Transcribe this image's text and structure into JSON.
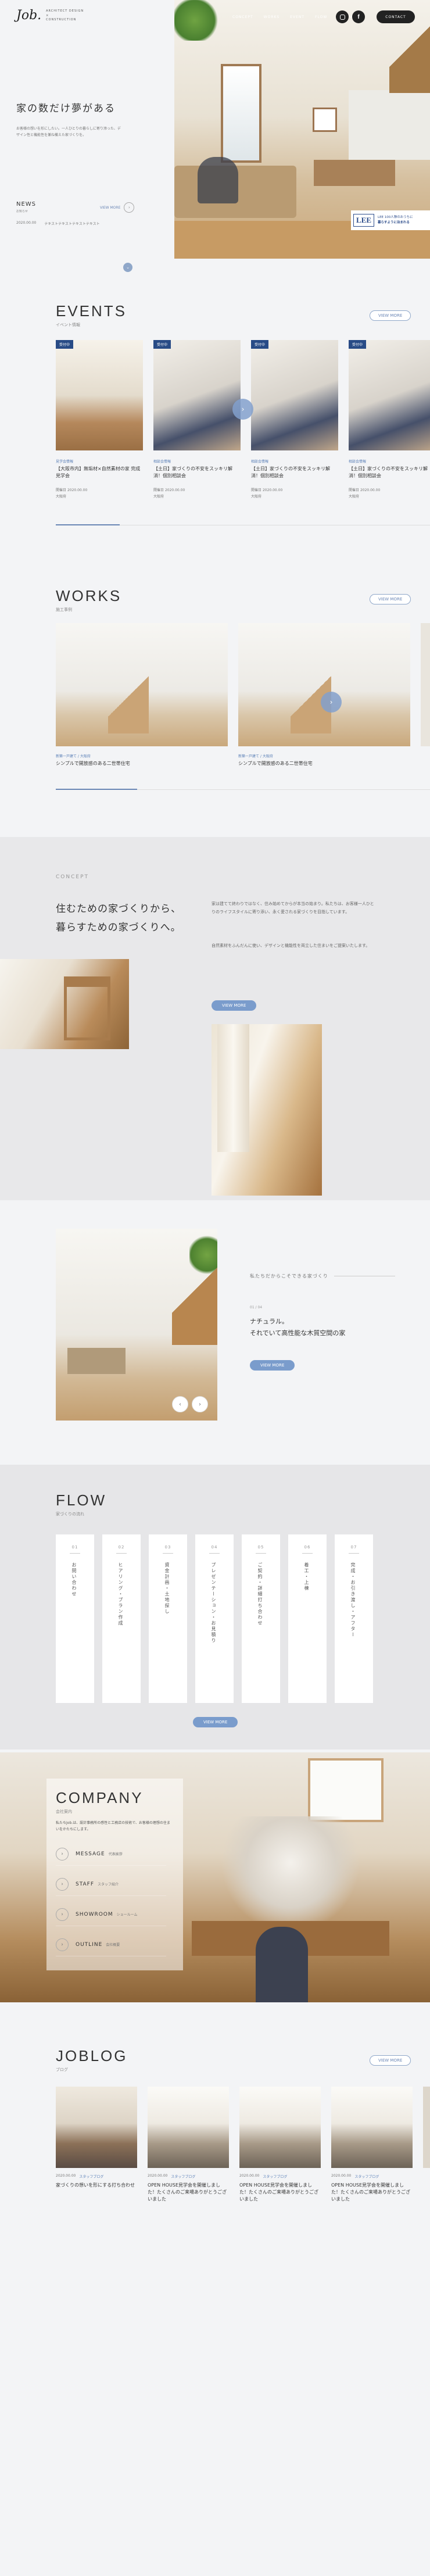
{
  "header": {
    "logo": "Job.",
    "logo_sub1": "ARCHITECT DESIGN",
    "logo_sub2": "×",
    "logo_sub3": "CONSTRUCTION",
    "nav": [
      "CONCEPT",
      "WORKS",
      "EVENT",
      "FLOW",
      "COMPANY"
    ],
    "contact_label": "CONTACT"
  },
  "hero": {
    "heading": "家の数だけ夢がある",
    "body": "お客様の想いを形にしたい。一人ひとりの暮らしに寄り添った、デザイン性と機能性を兼ね備えた家づくりを。",
    "news_label": "NEWS",
    "news_sub": "お知らせ",
    "news_more": "VIEW MORE",
    "news_date": "2020.00.00",
    "news_text": "テキストテキストテキストテキスト",
    "lee_logo": "LEE",
    "lee_text1": "LEE 100人隊のおうちに",
    "lee_text2": "暮らすように泊まれる",
    "colors": {
      "accent": "#284b86",
      "button": "#7a9ccc"
    }
  },
  "events": {
    "title": "EVENTS",
    "sub": "イベント情報",
    "more": "VIEW MORE",
    "items": [
      {
        "badge": "受付中",
        "cat": "見学会情報",
        "title": "【大阪市内】無垢材×自然素材の家 完成見学会",
        "date": "開催日",
        "date_val": "2020.00.00",
        "place": "大阪府"
      },
      {
        "badge": "受付中",
        "cat": "相談会情報",
        "title": "【土日】家づくりの不安をスッキリ解消！個別相談会",
        "date": "開催日",
        "date_val": "2020.00.00",
        "place": "大阪府"
      },
      {
        "badge": "受付中",
        "cat": "相談会情報",
        "title": "【土日】家づくりの不安をスッキリ解消！個別相談会",
        "date": "開催日",
        "date_val": "2020.00.00",
        "place": "大阪府"
      },
      {
        "badge": "受付中",
        "cat": "相談会情報",
        "title": "【土日】家づくりの不安をスッキリ解消！個別相談会",
        "date": "開催日",
        "date_val": "2020.00.00",
        "place": "大阪府"
      }
    ]
  },
  "works": {
    "title": "WORKS",
    "sub": "施工事例",
    "more": "VIEW MORE",
    "items": [
      {
        "cat": "新築一戸建て / 大阪府",
        "title": "シンプルで開放感のある二世帯住宅"
      },
      {
        "cat": "新築一戸建て / 大阪府",
        "title": "シンプルで開放感のある二世帯住宅"
      }
    ]
  },
  "concept": {
    "label": "CONCEPT",
    "heading1": "住むための家づくりから、",
    "heading2": "暮らすための家づくりへ。",
    "body1": "家は建てて終わりではなく、住み始めてからが本当の始まり。私たちは、お客様一人ひとりのライフスタイルに寄り添い、永く愛される家づくりを目指しています。",
    "body2": "自然素材をふんだんに使い、デザインと機能性を両立した住まいをご提案いたします。",
    "more": "VIEW MORE"
  },
  "natural": {
    "label": "私たちだからこそできる家づくり",
    "num": "01 / 04",
    "heading1": "ナチュラル。",
    "heading2": "それでいて高性能な木質空間の家",
    "more": "VIEW MORE"
  },
  "flow": {
    "title": "FLOW",
    "sub": "家づくりの流れ",
    "more": "VIEW MORE",
    "steps": [
      {
        "num": "01",
        "text": "お問い合わせ"
      },
      {
        "num": "02",
        "text": "ヒアリング・プラン作成"
      },
      {
        "num": "03",
        "text": "資金計画・土地探し"
      },
      {
        "num": "04",
        "text": "プレゼンテーション・お見積り"
      },
      {
        "num": "05",
        "text": "ご契約・詳細打ち合わせ"
      },
      {
        "num": "06",
        "text": "着工・上棟"
      },
      {
        "num": "07",
        "text": "完成・お引き渡し・アフター"
      }
    ]
  },
  "company": {
    "title": "COMPANY",
    "sub": "会社案内",
    "body": "私たちJob.は、設計事務所の感性と工務店の技術で、お客様の理想の住まいをかたちにします。",
    "items": [
      {
        "label": "MESSAGE",
        "sub": "代表挨拶"
      },
      {
        "label": "STAFF",
        "sub": "スタッフ紹介"
      },
      {
        "label": "SHOWROOM",
        "sub": "ショールーム"
      },
      {
        "label": "OUTLINE",
        "sub": "会社概要"
      }
    ]
  },
  "blog": {
    "title": "JOBLOG",
    "sub": "ブログ",
    "more": "VIEW MORE",
    "items": [
      {
        "date": "2020.00.00",
        "tag": "スタッフブログ",
        "title": "家づくりの想いを形にする打ち合わせ"
      },
      {
        "date": "2020.00.00",
        "tag": "スタッフブログ",
        "title": "OPEN HOUSE見学会を開催しました！たくさんのご来場ありがとうございました"
      },
      {
        "date": "2020.00.00",
        "tag": "スタッフブログ",
        "title": "OPEN HOUSE見学会を開催しました！たくさんのご来場ありがとうございました"
      },
      {
        "date": "2020.00.00",
        "tag": "スタッフブログ",
        "title": "OPEN HOUSE見学会を開催しました！たくさんのご来場ありがとうございました"
      }
    ]
  }
}
